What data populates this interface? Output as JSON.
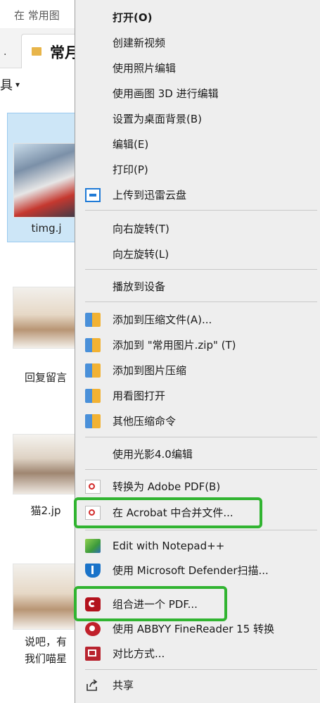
{
  "explorer": {
    "address_text": "在 常用图",
    "tab_prev_label": ".",
    "tab_active_label": "常月",
    "toolbar_label": "具",
    "toolbar_caret": "▾",
    "files": [
      {
        "name": "timg.j",
        "selected": true
      },
      {
        "name": "回复留言"
      },
      {
        "name": "猫2.jp"
      },
      {
        "name_line1": "说吧，有",
        "name_line2": "我们喵星"
      }
    ]
  },
  "menu": {
    "items": [
      {
        "label": "打开(O)",
        "bold": true
      },
      {
        "label": "创建新视频"
      },
      {
        "label": "使用照片编辑"
      },
      {
        "label": "使用画图 3D 进行编辑"
      },
      {
        "label": "设置为桌面背景(B)"
      },
      {
        "label": "编辑(E)"
      },
      {
        "label": "打印(P)"
      },
      {
        "label": "上传到迅雷云盘",
        "icon": "cloud-upload-icon"
      },
      {
        "label": "向右旋转(T)"
      },
      {
        "label": "向左旋转(L)"
      },
      {
        "label": "播放到设备"
      },
      {
        "label": "添加到压缩文件(A)...",
        "icon": "archive-icon"
      },
      {
        "label": "添加到 \"常用图片.zip\" (T)",
        "icon": "archive-icon"
      },
      {
        "label": "添加到图片压缩",
        "icon": "archive-icon"
      },
      {
        "label": "用看图打开",
        "icon": "archive-icon"
      },
      {
        "label": "其他压缩命令",
        "icon": "archive-icon"
      },
      {
        "label": "使用光影4.0编辑"
      },
      {
        "label": "转换为 Adobe PDF(B)",
        "icon": "pdf-icon"
      },
      {
        "label": "在 Acrobat 中合并文件...",
        "icon": "pdf-icon"
      },
      {
        "label": "Edit with Notepad++",
        "icon": "notepad-icon"
      },
      {
        "label": "使用 Microsoft Defender扫描...",
        "icon": "shield-icon"
      },
      {
        "label": "组合进一个 PDF...",
        "icon": "acrobat-icon"
      },
      {
        "label": "使用 ABBYY FineReader 15 转换",
        "icon": "abbyy-icon"
      },
      {
        "label": "对比方式...",
        "icon": "compare-icon"
      },
      {
        "label": "共享",
        "icon": "share-icon"
      }
    ]
  },
  "colors": {
    "menu_bg": "#eeeeee",
    "highlight_border": "#31b431",
    "selection_bg": "#cde6f7"
  }
}
